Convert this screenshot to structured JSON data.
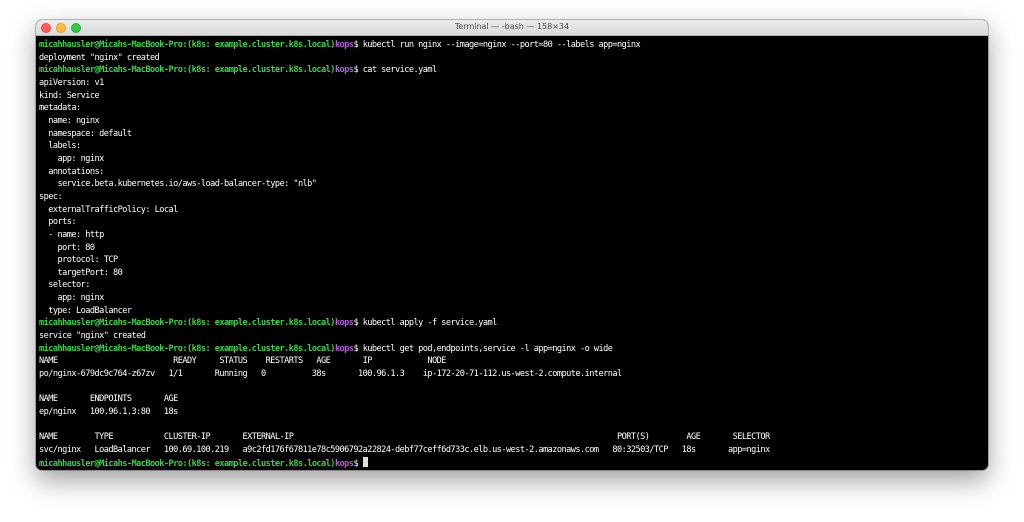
{
  "window": {
    "title": "Terminal — -bash — 158×34"
  },
  "prompt": {
    "user_host": "micahhausler@Micahs-MacBook-Pro",
    "context": ":(k8s: example.cluster.k8s.local)",
    "profile": "kops",
    "symbol": "$ "
  },
  "lines": [
    {
      "type": "cmd",
      "text": "kubectl run nginx --image=nginx --port=80 --labels app=nginx"
    },
    {
      "type": "out",
      "text": "deployment \"nginx\" created"
    },
    {
      "type": "cmd",
      "text": "cat service.yaml"
    },
    {
      "type": "out",
      "text": "apiVersion: v1"
    },
    {
      "type": "out",
      "text": "kind: Service"
    },
    {
      "type": "out",
      "text": "metadata:"
    },
    {
      "type": "out",
      "text": "  name: nginx"
    },
    {
      "type": "out",
      "text": "  namespace: default"
    },
    {
      "type": "out",
      "text": "  labels:"
    },
    {
      "type": "out",
      "text": "    app: nginx"
    },
    {
      "type": "out",
      "text": "  annotations:"
    },
    {
      "type": "out",
      "text": "    service.beta.kubernetes.io/aws-load-balancer-type: \"nlb\""
    },
    {
      "type": "out",
      "text": "spec:"
    },
    {
      "type": "out",
      "text": "  externalTrafficPolicy: Local"
    },
    {
      "type": "out",
      "text": "  ports:"
    },
    {
      "type": "out",
      "text": "  - name: http"
    },
    {
      "type": "out",
      "text": "    port: 80"
    },
    {
      "type": "out",
      "text": "    protocol: TCP"
    },
    {
      "type": "out",
      "text": "    targetPort: 80"
    },
    {
      "type": "out",
      "text": "  selector:"
    },
    {
      "type": "out",
      "text": "    app: nginx"
    },
    {
      "type": "out",
      "text": "  type: LoadBalancer"
    },
    {
      "type": "cmd",
      "text": "kubectl apply -f service.yaml"
    },
    {
      "type": "out",
      "text": "service \"nginx\" created"
    },
    {
      "type": "cmd",
      "text": "kubectl get pod,endpoints,service -l app=nginx -o wide"
    },
    {
      "type": "out",
      "text": "NAME                         READY     STATUS    RESTARTS   AGE       IP            NODE"
    },
    {
      "type": "out",
      "text": "po/nginx-679dc9c764-z67zv   1/1       Running   0          38s       100.96.1.3    ip-172-20-71-112.us-west-2.compute.internal"
    },
    {
      "type": "out",
      "text": ""
    },
    {
      "type": "out",
      "text": "NAME       ENDPOINTS       AGE"
    },
    {
      "type": "out",
      "text": "ep/nginx   100.96.1.3:80   18s"
    },
    {
      "type": "out",
      "text": ""
    },
    {
      "type": "out",
      "text": "NAME        TYPE           CLUSTER-IP       EXTERNAL-IP                                                                      PORT(S)        AGE       SELECTOR"
    },
    {
      "type": "out",
      "text": "svc/nginx   LoadBalancer   100.69.100.219   a9c2fd176f67811e78c5906792a22824-debf77ceff6d733c.elb.us-west-2.amazonaws.com   80:32503/TCP   18s       app=nginx"
    },
    {
      "type": "prompt",
      "text": ""
    }
  ],
  "colors": {
    "background": "#000000",
    "foreground": "#ffffff",
    "prompt_host": "#3cd04a",
    "prompt_profile": "#b35ddd",
    "cursor": "#dcdcdc"
  }
}
